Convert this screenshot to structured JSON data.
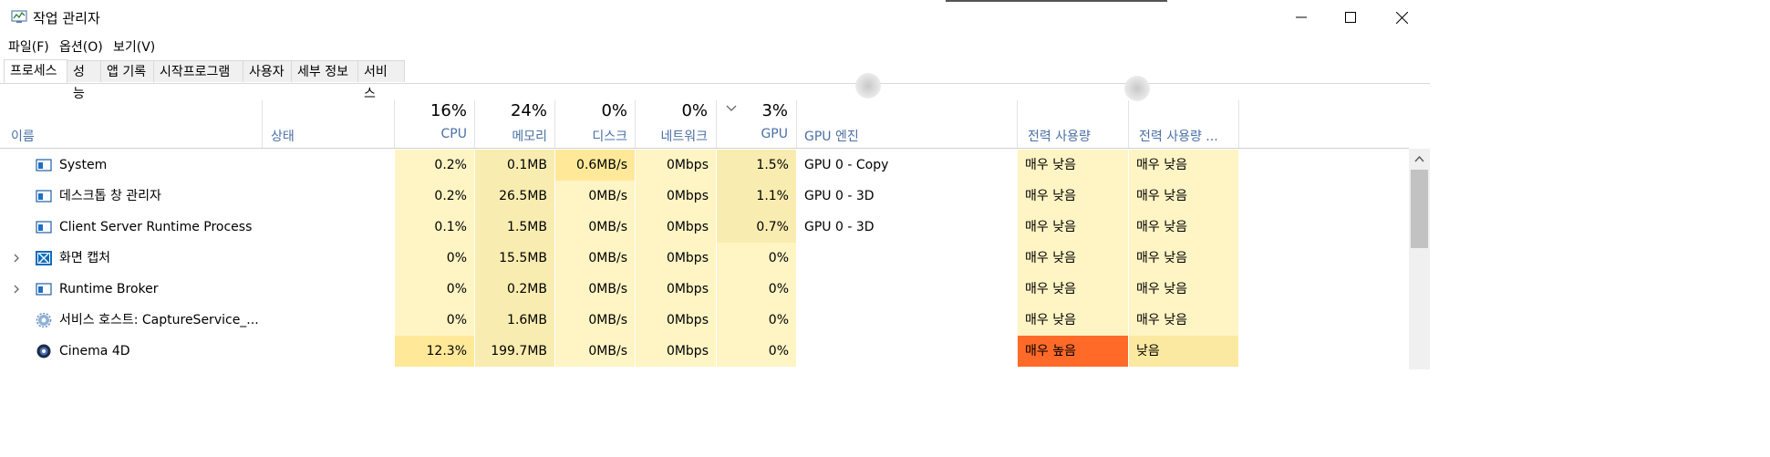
{
  "window": {
    "title": "작업 관리자",
    "minimize_icon": "minimize-icon",
    "maximize_icon": "maximize-icon",
    "close_icon": "close-icon"
  },
  "menu": [
    "파일(F)",
    "옵션(O)",
    "보기(V)"
  ],
  "tabs": [
    "프로세스",
    "성능",
    "앱 기록",
    "시작프로그램",
    "사용자",
    "세부 정보",
    "서비스"
  ],
  "header": {
    "name": "이름",
    "status": "상태",
    "cpu_pct": "16%",
    "cpu": "CPU",
    "mem_pct": "24%",
    "mem": "메모리",
    "disk_pct": "0%",
    "disk": "디스크",
    "net_pct": "0%",
    "net": "네트워크",
    "gpu_pct": "3%",
    "gpu": "GPU",
    "gpu_engine": "GPU 엔진",
    "power": "전력 사용량",
    "power_trend": "전력 사용량 ..."
  },
  "rows": [
    {
      "name": "System",
      "cpu": "0.2%",
      "mem": "0.1MB",
      "disk": "0.6MB/s",
      "net": "0Mbps",
      "gpu": "1.5%",
      "gpu_engine": "GPU 0 - Copy",
      "power": "매우 낮음",
      "power_trend": "매우 낮음",
      "icon": "window-icon"
    },
    {
      "name": "데스크톱 창 관리자",
      "cpu": "0.2%",
      "mem": "26.5MB",
      "disk": "0MB/s",
      "net": "0Mbps",
      "gpu": "1.1%",
      "gpu_engine": "GPU 0 - 3D",
      "power": "매우 낮음",
      "power_trend": "매우 낮음",
      "icon": "window-icon"
    },
    {
      "name": "Client Server Runtime Process",
      "cpu": "0.1%",
      "mem": "1.5MB",
      "disk": "0MB/s",
      "net": "0Mbps",
      "gpu": "0.7%",
      "gpu_engine": "GPU 0 - 3D",
      "power": "매우 낮음",
      "power_trend": "매우 낮음",
      "icon": "window-icon"
    },
    {
      "name": "화면 캡처",
      "cpu": "0%",
      "mem": "15.5MB",
      "disk": "0MB/s",
      "net": "0Mbps",
      "gpu": "0%",
      "gpu_engine": "",
      "power": "매우 낮음",
      "power_trend": "매우 낮음",
      "icon": "screen-capture-icon"
    },
    {
      "name": "Runtime Broker",
      "cpu": "0%",
      "mem": "0.2MB",
      "disk": "0MB/s",
      "net": "0Mbps",
      "gpu": "0%",
      "gpu_engine": "",
      "power": "매우 낮음",
      "power_trend": "매우 낮음",
      "icon": "window-icon"
    },
    {
      "name": "서비스 호스트: CaptureService_...",
      "cpu": "0%",
      "mem": "1.6MB",
      "disk": "0MB/s",
      "net": "0Mbps",
      "gpu": "0%",
      "gpu_engine": "",
      "power": "매우 낮음",
      "power_trend": "매우 낮음",
      "icon": "gear-icon"
    },
    {
      "name": "Cinema 4D",
      "cpu": "12.3%",
      "mem": "199.7MB",
      "disk": "0MB/s",
      "net": "0Mbps",
      "gpu": "0%",
      "gpu_engine": "",
      "power": "매우 높음",
      "power_trend": "낮음",
      "icon": "cinema4d-icon"
    }
  ],
  "colors": {
    "heat_light": "#fff4c4",
    "heat_medium": "#f9ecb0",
    "heat_strong": "#ffe999",
    "power_high": "#ff6a28",
    "header_label": "#4a6fa5"
  }
}
